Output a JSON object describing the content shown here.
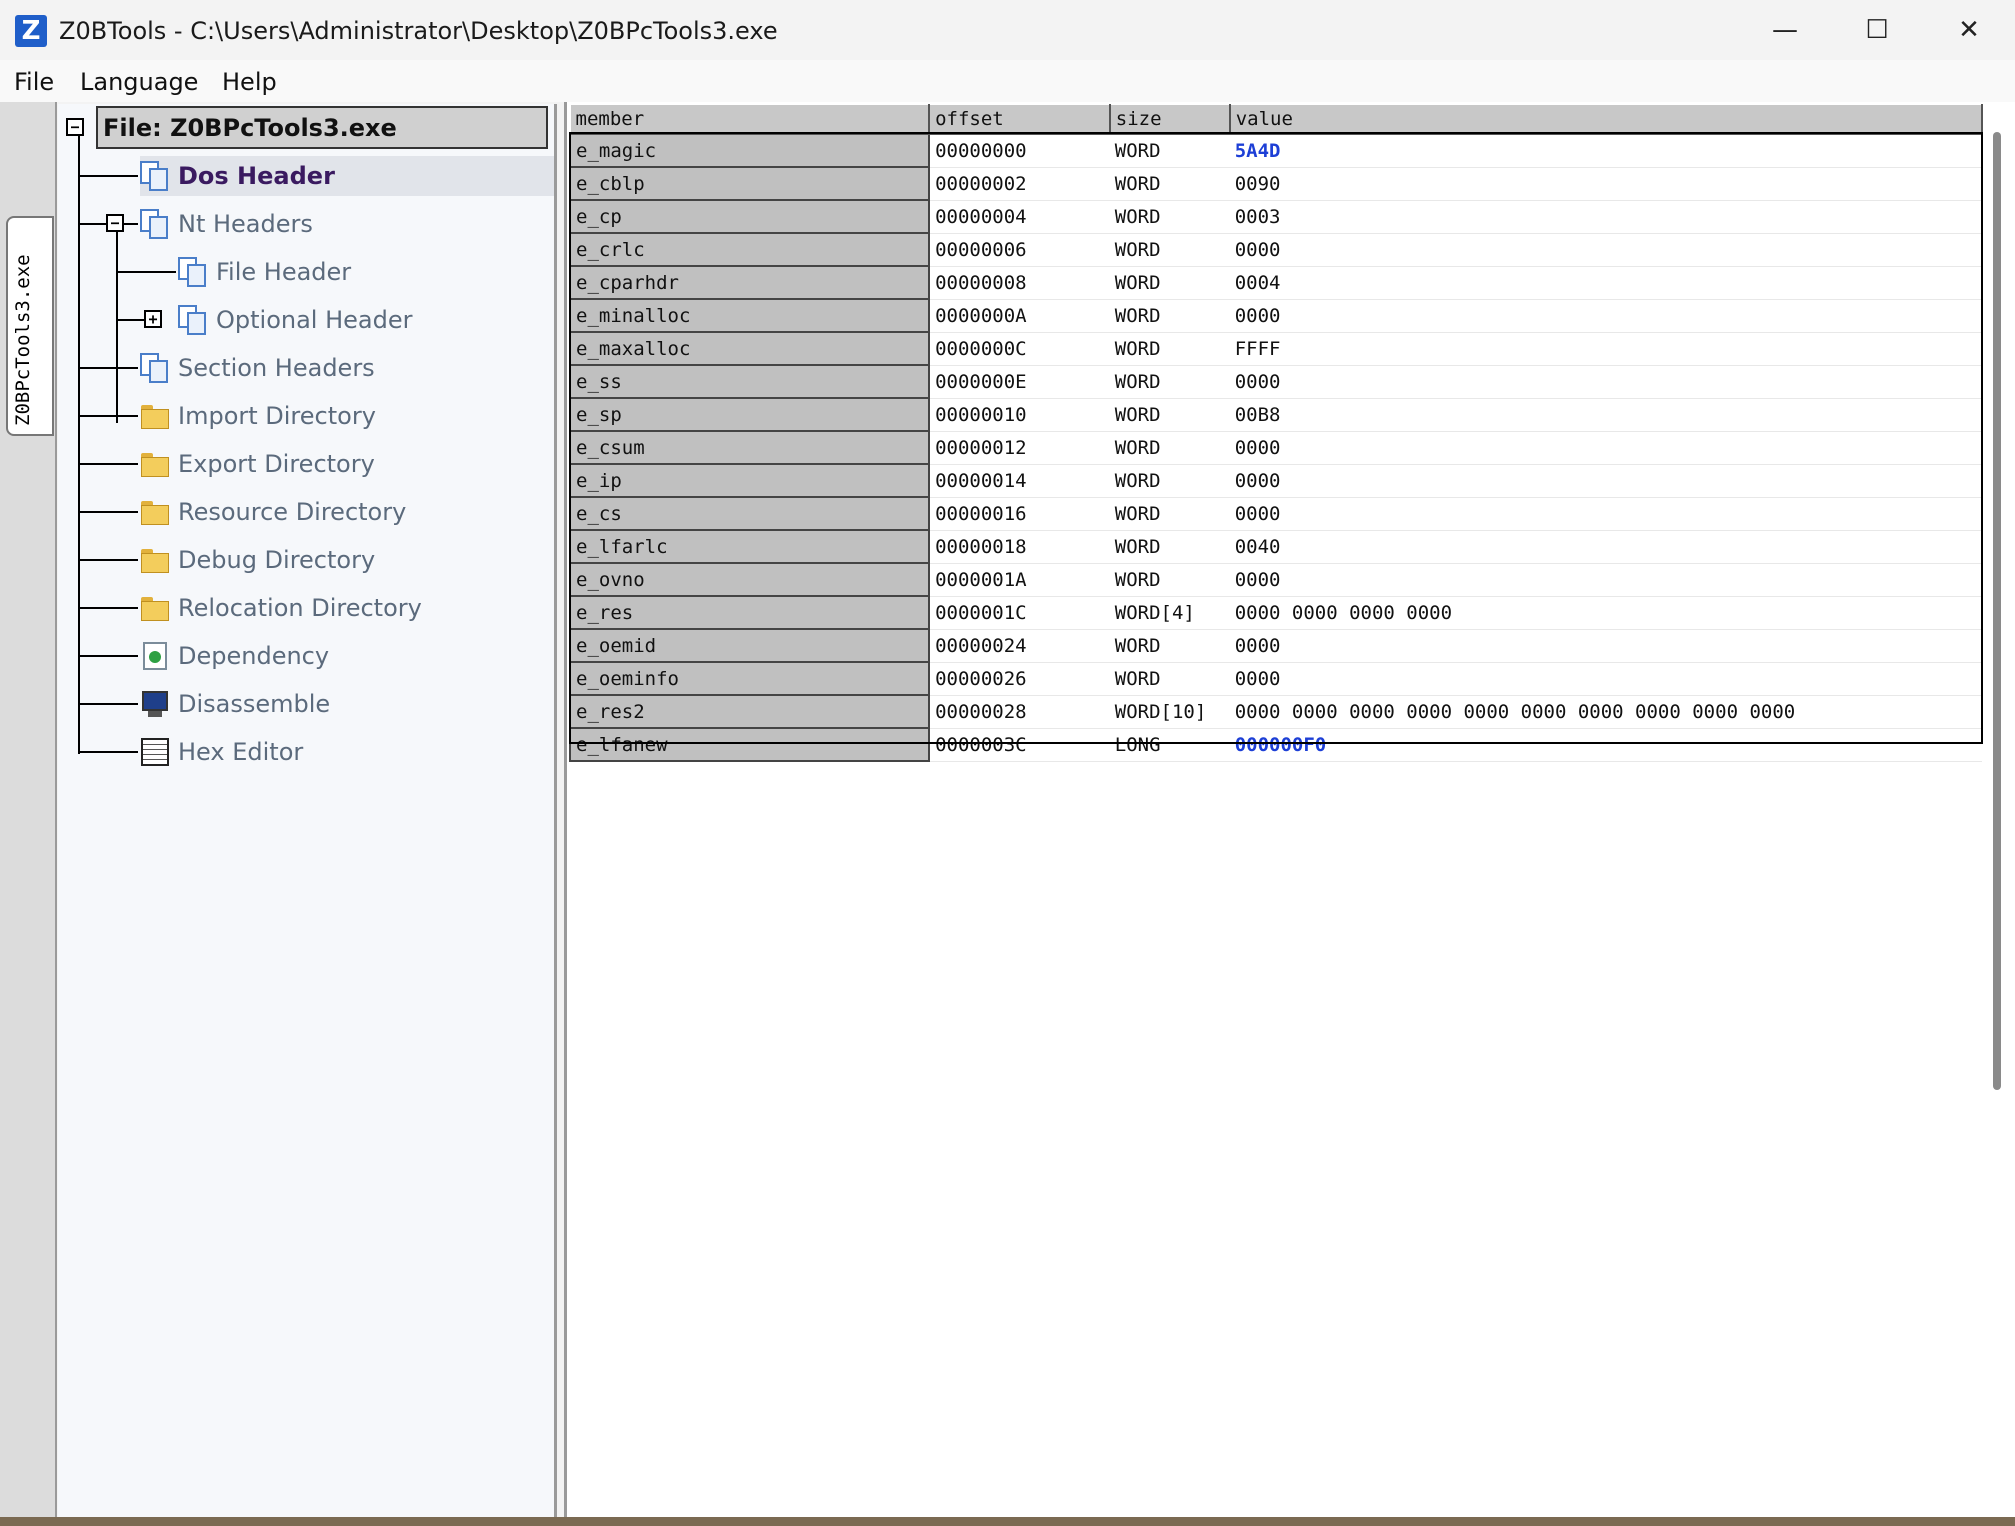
{
  "window": {
    "title": "Z0BTools - C:\\Users\\Administrator\\Desktop\\Z0BPcTools3.exe",
    "app_icon_letter": "Z",
    "minimize_glyph": "—",
    "maximize_glyph": "☐",
    "close_glyph": "✕"
  },
  "menu": {
    "file": "File",
    "language": "Language",
    "help": "Help"
  },
  "file_tab": {
    "label": "Z0BPcTools3.exe"
  },
  "tree": {
    "root_label": "File: Z0BPcTools3.exe",
    "collapse_glyph": "−",
    "expand_glyph": "+",
    "nodes": {
      "dos_header": "Dos Header",
      "nt_headers": "Nt Headers",
      "file_header": "File Header",
      "optional_header": "Optional Header",
      "section_headers": "Section Headers",
      "import_directory": "Import Directory",
      "export_directory": "Export Directory",
      "resource_directory": "Resource Directory",
      "debug_directory": "Debug Directory",
      "relocation_directory": "Relocation Directory",
      "dependency": "Dependency",
      "disassemble": "Disassemble",
      "hex_editor": "Hex Editor"
    }
  },
  "grid": {
    "headers": {
      "member": "member",
      "offset": "offset",
      "size": "size",
      "value": "value"
    },
    "highlight_color": "#1d3fd6",
    "rows": [
      {
        "member": "e_magic",
        "offset": "00000000",
        "size": "WORD",
        "value": "5A4D"
      },
      {
        "member": "e_cblp",
        "offset": "00000002",
        "size": "WORD",
        "value": "0090"
      },
      {
        "member": "e_cp",
        "offset": "00000004",
        "size": "WORD",
        "value": "0003"
      },
      {
        "member": "e_crlc",
        "offset": "00000006",
        "size": "WORD",
        "value": "0000"
      },
      {
        "member": "e_cparhdr",
        "offset": "00000008",
        "size": "WORD",
        "value": "0004"
      },
      {
        "member": "e_minalloc",
        "offset": "0000000A",
        "size": "WORD",
        "value": "0000"
      },
      {
        "member": "e_maxalloc",
        "offset": "0000000C",
        "size": "WORD",
        "value": "FFFF"
      },
      {
        "member": "e_ss",
        "offset": "0000000E",
        "size": "WORD",
        "value": "0000"
      },
      {
        "member": "e_sp",
        "offset": "00000010",
        "size": "WORD",
        "value": "00B8"
      },
      {
        "member": "e_csum",
        "offset": "00000012",
        "size": "WORD",
        "value": "0000"
      },
      {
        "member": "e_ip",
        "offset": "00000014",
        "size": "WORD",
        "value": "0000"
      },
      {
        "member": "e_cs",
        "offset": "00000016",
        "size": "WORD",
        "value": "0000"
      },
      {
        "member": "e_lfarlc",
        "offset": "00000018",
        "size": "WORD",
        "value": "0040"
      },
      {
        "member": "e_ovno",
        "offset": "0000001A",
        "size": "WORD",
        "value": "0000"
      },
      {
        "member": "e_res",
        "offset": "0000001C",
        "size": "WORD[4]",
        "value": "0000 0000 0000 0000"
      },
      {
        "member": "e_oemid",
        "offset": "00000024",
        "size": "WORD",
        "value": "0000"
      },
      {
        "member": "e_oeminfo",
        "offset": "00000026",
        "size": "WORD",
        "value": "0000"
      },
      {
        "member": "e_res2",
        "offset": "00000028",
        "size": "WORD[10]",
        "value": "0000 0000 0000 0000 0000 0000 0000 0000 0000 0000"
      },
      {
        "member": "e_lfanew",
        "offset": "0000003C",
        "size": "LONG",
        "value": "000000F0"
      }
    ]
  }
}
